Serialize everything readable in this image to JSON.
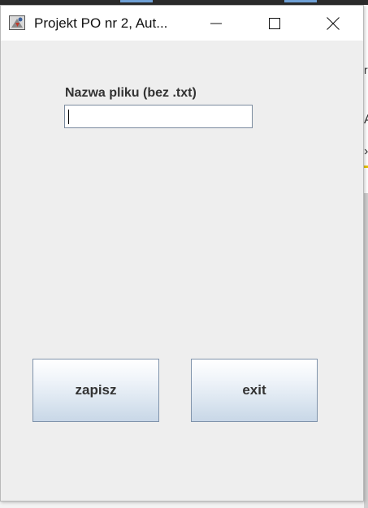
{
  "window": {
    "title": "Projekt PO nr 2, Aut...",
    "controls": {
      "minimize_icon": "minimize-icon",
      "maximize_icon": "maximize-icon",
      "close_icon": "close-icon"
    }
  },
  "form": {
    "filename_label": "Nazwa pliku (bez .txt)",
    "filename_value": "",
    "filename_placeholder": ""
  },
  "buttons": {
    "save_label": "zapisz",
    "exit_label": "exit"
  },
  "colors": {
    "window_bg": "#eeeeee",
    "titlebar_bg": "#ffffff",
    "label_text": "#333333",
    "button_border": "#7f93ab"
  }
}
